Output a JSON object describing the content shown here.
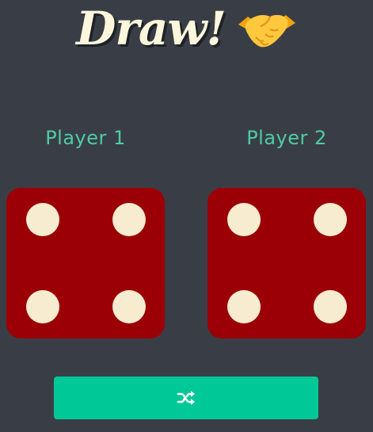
{
  "title": {
    "text": "Draw!",
    "emoji_icon": "handshake-icon"
  },
  "players": [
    {
      "label": "Player 1",
      "die_value": 4
    },
    {
      "label": "Player 2",
      "die_value": 4
    }
  ],
  "roll_button": {
    "icon": "shuffle-icon",
    "color": "#00c896"
  },
  "colors": {
    "background": "#393e46",
    "player_label": "#4ecca3",
    "die_face": "#9b0006",
    "pip": "#f8ecd0",
    "title": "#fcf6dc"
  }
}
